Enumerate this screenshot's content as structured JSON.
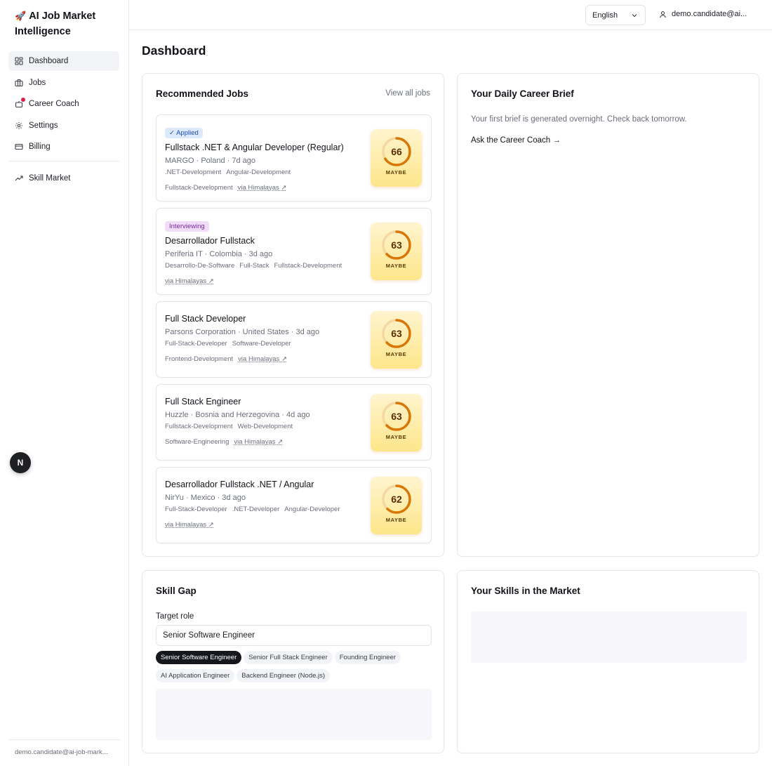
{
  "app": {
    "brand_emoji": "🚀",
    "brand_title": "AI Job Market Intelligence"
  },
  "sidebar": {
    "items": [
      {
        "label": "Dashboard",
        "icon": "dashboard-icon",
        "active": true
      },
      {
        "label": "Jobs",
        "icon": "briefcase-icon"
      },
      {
        "label": "Career Coach",
        "icon": "coach-icon",
        "notification": true
      },
      {
        "label": "Settings",
        "icon": "gear-icon"
      },
      {
        "label": "Billing",
        "icon": "card-icon"
      }
    ],
    "secondary": [
      {
        "label": "Skill Market",
        "icon": "trend-icon"
      }
    ],
    "footer_email": "demo.candidate@ai-job-mark..."
  },
  "next_badge": "N",
  "topbar": {
    "language": "English",
    "user_email": "demo.candidate@ai..."
  },
  "page_title": "Dashboard",
  "recommended": {
    "title": "Recommended Jobs",
    "view_all": "View all jobs",
    "jobs": [
      {
        "status": "✓ Applied",
        "status_type": "applied",
        "title": "Fullstack .NET & Angular Developer (Regular)",
        "meta": "MARGO · Poland · 7d ago",
        "tags": [
          ".NET-Development",
          "Angular-Development"
        ],
        "tags_row2": [
          "Fullstack-Development"
        ],
        "via": "via Himalayas ↗",
        "score": 66,
        "score_label": "MAYBE"
      },
      {
        "status": "Interviewing",
        "status_type": "interviewing",
        "title": "Desarrollador Fullstack",
        "meta": "Periferia IT · Colombia · 3d ago",
        "tags": [
          "Desarrollo-De-Software",
          "Full-Stack",
          "Fullstack-Development"
        ],
        "tags_row2": [],
        "via": "via Himalayas ↗",
        "score": 63,
        "score_label": "MAYBE"
      },
      {
        "status": "",
        "status_type": "",
        "title": "Full Stack Developer",
        "meta": "Parsons Corporation · United States · 3d ago",
        "tags": [
          "Full-Stack-Developer",
          "Software-Developer"
        ],
        "tags_row2": [
          "Frontend-Development"
        ],
        "via": "via Himalayas ↗",
        "score": 63,
        "score_label": "MAYBE"
      },
      {
        "status": "",
        "status_type": "",
        "title": "Full Stack Engineer",
        "meta": "Huzzle · Bosnia and Herzegovina · 4d ago",
        "tags": [
          "Fullstack-Development",
          "Web-Development"
        ],
        "tags_row2": [
          "Software-Engineering"
        ],
        "via": "via Himalayas ↗",
        "score": 63,
        "score_label": "MAYBE"
      },
      {
        "status": "",
        "status_type": "",
        "title": "Desarrollador Fullstack .NET / Angular",
        "meta": "NirYu · Mexico · 3d ago",
        "tags": [
          "Full-Stack-Developer",
          ".NET-Developer",
          "Angular-Developer"
        ],
        "tags_row2": [],
        "via": "via Himalayas ↗",
        "score": 62,
        "score_label": "MAYBE"
      }
    ]
  },
  "brief": {
    "title": "Your Daily Career Brief",
    "text": "Your first brief is generated overnight. Check back tomorrow.",
    "link": "Ask the Career Coach →"
  },
  "skill_gap": {
    "title": "Skill Gap",
    "target_label": "Target role",
    "target_value": "Senior Software Engineer",
    "roles": [
      {
        "label": "Senior Software Engineer",
        "active": true
      },
      {
        "label": "Senior Full Stack Engineer"
      },
      {
        "label": "Founding Engineer"
      },
      {
        "label": "AI Application Engineer"
      },
      {
        "label": "Backend Engineer (Node.js)"
      }
    ]
  },
  "skills_market": {
    "title": "Your Skills in the Market"
  },
  "colors": {
    "score_ring": "#d97706",
    "score_track": "#f3d9a1",
    "chip_active": "#15171c",
    "notification": "#e11d48"
  }
}
